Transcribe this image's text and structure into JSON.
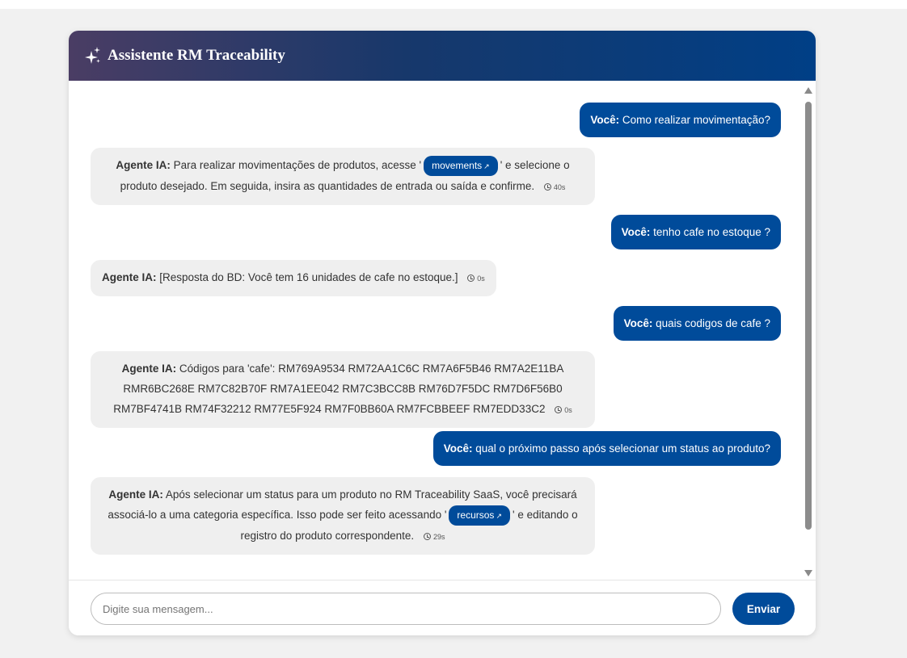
{
  "header": {
    "title": "Assistente RM Traceability",
    "icon": "sparkles-icon"
  },
  "user_prefix": "Você:",
  "agent_prefix": "Agente IA:",
  "messages": [
    {
      "role": "user",
      "text": "Como realizar movimentação?"
    },
    {
      "role": "agent",
      "before": "Para realizar movimentações de produtos, acesse '",
      "link": "movements",
      "after": "' e selecione o produto desejado. Em seguida, insira as quantidades de entrada ou saída e confirme.",
      "time": "40s"
    },
    {
      "role": "user",
      "text": "tenho cafe no estoque ?"
    },
    {
      "role": "agent",
      "before": "[Resposta do BD: Você tem 16 unidades de cafe no estoque.]",
      "time": "0s"
    },
    {
      "role": "user",
      "text": "quais codigos de cafe ?"
    },
    {
      "role": "agent",
      "before": "Códigos para 'cafe': RM769A9534 RM72AA1C6C RM7A6F5B46 RM7A2E11BA RMR6BC268E RM7C82B70F RM7A1EE042 RM7C3BCC8B RM76D7F5DC RM7D6F56B0 RM7BF4741B RM74F32212 RM77E5F924 RM7F0BB60A RM7FCBBEEF RM7EDD33C2",
      "time": "0s"
    },
    {
      "role": "user",
      "text": "qual o próximo passo após selecionar um status ao produto?"
    },
    {
      "role": "agent",
      "before": "Após selecionar um status para um produto no RM Traceability SaaS, você precisará associá-lo a uma categoria específica. Isso pode ser feito acessando '",
      "link": "recursos",
      "after": "' e editando o registro do produto correspondente.",
      "time": "29s"
    }
  ],
  "footer": {
    "placeholder": "Digite sua mensagem...",
    "send_label": "Enviar"
  }
}
